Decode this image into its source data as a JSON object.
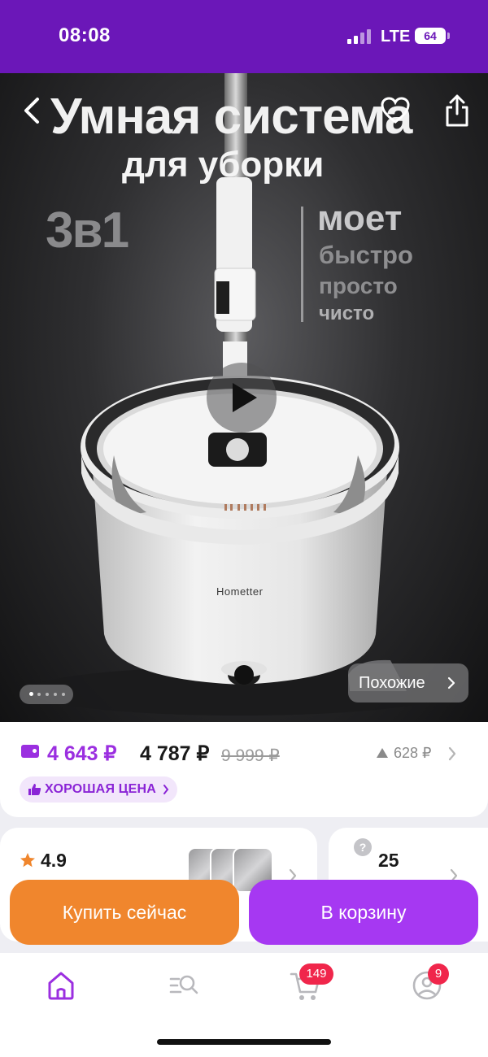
{
  "status_bar": {
    "time": "08:08",
    "network": "LTE",
    "battery": "64"
  },
  "hero": {
    "title_line1": "Умная система",
    "title_line2": "для уборки",
    "badge_3v1": "3в1",
    "tagline_main": "моет",
    "tagline_words": [
      "быстро",
      "просто",
      "чисто"
    ],
    "brand_on_product": "Hometter",
    "similar_label": "Похожие",
    "image_count": 5,
    "active_image_index": 0
  },
  "price": {
    "card_price": "4 643 ₽",
    "regular_price": "4 787 ₽",
    "old_price": "9 999 ₽",
    "price_drop": "628 ₽",
    "good_price_badge": "ХОРОШАЯ ЦЕНА"
  },
  "rating": {
    "value": "4.9"
  },
  "reviews": {
    "count": "25"
  },
  "actions": {
    "buy_now": "Купить сейчас",
    "add_to_cart": "В корзину"
  },
  "tabbar": {
    "cart_count": "149",
    "profile_count": "9"
  },
  "colors": {
    "status_bar": "#6b17b8",
    "accent_purple": "#9b2fe0",
    "buy_orange": "#f0862d",
    "cart_purple": "#a638f2",
    "badge_red": "#f0264b"
  },
  "icons": [
    "back-arrow-icon",
    "heart-icon",
    "share-icon",
    "play-icon",
    "wallet-icon",
    "arrow-up-icon",
    "thumbs-up-icon",
    "star-icon",
    "question-icon",
    "home-icon",
    "catalog-search-icon",
    "cart-icon",
    "profile-icon"
  ]
}
